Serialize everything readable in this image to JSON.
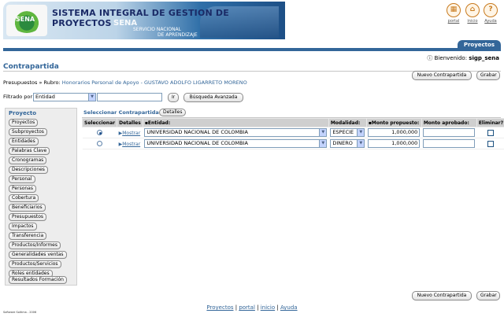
{
  "header": {
    "app_title": "SISTEMA INTEGRAL DE GESTION DE PROYECTOS",
    "logo_text": "SENA",
    "banner_sena": "SENA",
    "banner_sub1": "SERVICIO NACIONAL",
    "banner_sub2": "DE APRENDIZAJE",
    "icons": [
      {
        "icon": "portal-icon",
        "label": "portal"
      },
      {
        "icon": "home-icon",
        "label": "inicio"
      },
      {
        "icon": "help-icon",
        "label": "Ayuda"
      }
    ]
  },
  "tabs": {
    "active": "Proyectos"
  },
  "user": {
    "greeting": "Bienvenido:",
    "username": "sigp_sena"
  },
  "page": {
    "title": "Contrapartida"
  },
  "actions": {
    "new_label": "Nuevo Contrapartida",
    "save_label": "Grabar"
  },
  "breadcrumb": {
    "prefix": "Presupuestos » Rubro:",
    "value": "Honorarios Personal de Apoyo - GUSTAVO ADOLFO LIGARRETO MORENO"
  },
  "filter": {
    "label": "Filtrado por",
    "selected": "Entidad",
    "text_value": "",
    "go_label": "Ir",
    "advanced_label": "Búsqueda Avanzada"
  },
  "sidebar": {
    "heading": "Proyecto",
    "items": [
      "Proyectos",
      "Subproyectos",
      "Entidades",
      "Palabras Clave",
      "Cronogramas",
      "Descripciones",
      "Personal",
      "Personas",
      "Cobertura",
      "Beneficiarios",
      "Presupuestos",
      "Impactos",
      "Transferencia",
      "Productos/Informes",
      "Generalidades ventas",
      "Productos/Servicios",
      "Roles entidades",
      "Resultados Formación"
    ]
  },
  "panel": {
    "title": "Seleccionar Contrapartida",
    "details_label": "Detalles",
    "columns": [
      "Seleccionar",
      "Detalles",
      "▪Entidad:",
      "Modalidad:",
      "▪Monto propuesto:",
      "Monto aprobado:",
      "Eliminar?"
    ],
    "rows": [
      {
        "selected": true,
        "detail_link": "Mostrar",
        "entidad": "UNIVERSIDAD NACIONAL DE COLOMBIA",
        "modalidad": "ESPECIE",
        "monto_propuesto": "1,000,000",
        "monto_aprobado": "",
        "eliminar": false
      },
      {
        "selected": false,
        "detail_link": "Mostrar",
        "entidad": "UNIVERSIDAD NACIONAL DE COLOMBIA",
        "modalidad": "DINERO",
        "monto_propuesto": "1,000,000",
        "monto_aprobado": "",
        "eliminar": false
      }
    ]
  },
  "footer": {
    "links": [
      "Proyectos",
      "portal",
      "inicio",
      "Ayuda"
    ],
    "copyright": "Software Soltima - 2006"
  },
  "colors": {
    "accent": "#336699",
    "header_bg": "#cfcfcf",
    "sidebar_bg": "#ededed"
  }
}
